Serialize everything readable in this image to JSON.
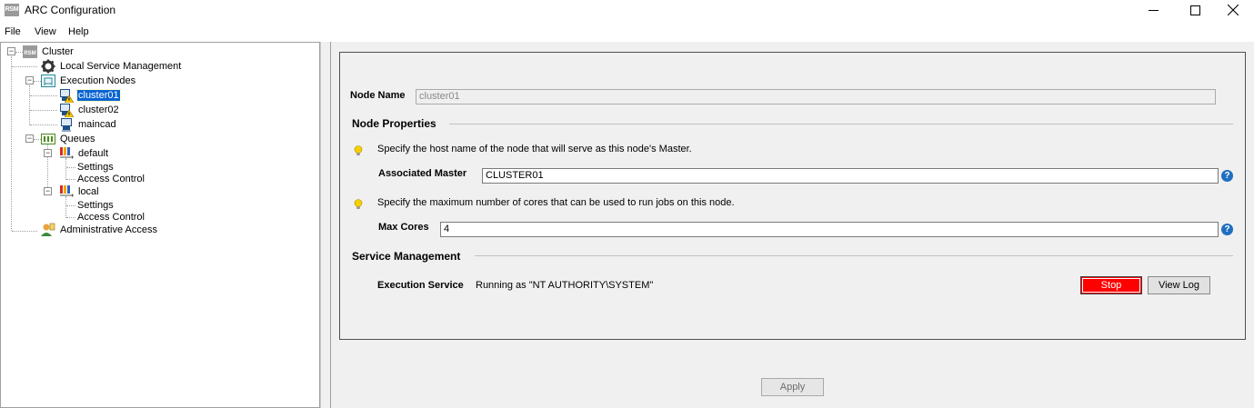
{
  "window": {
    "app_icon_text": "RSM",
    "title": "ARC Configuration"
  },
  "menu": {
    "items": [
      "File",
      "View",
      "Help"
    ]
  },
  "tree": {
    "root": "Cluster",
    "local_service_management": "Local Service Management",
    "execution_nodes": "Execution Nodes",
    "nodes": [
      "cluster01",
      "cluster02",
      "maincad"
    ],
    "queues": "Queues",
    "queue_default": "default",
    "queue_local": "local",
    "settings": "Settings",
    "access_control": "Access Control",
    "administrative_access": "Administrative Access",
    "selected": "cluster01"
  },
  "main": {
    "node_name_label": "Node Name",
    "node_name_value": "cluster01",
    "node_properties_title": "Node Properties",
    "master_hint": "Specify the host name of the node that will serve as this node's Master.",
    "associated_master_label": "Associated Master",
    "associated_master_value": "CLUSTER01",
    "cores_hint": "Specify the maximum number of cores that can be used to run jobs on this node.",
    "max_cores_label": "Max Cores",
    "max_cores_value": "4",
    "service_management_title": "Service Management",
    "execution_service_label": "Execution Service",
    "execution_service_status": "Running as \"NT AUTHORITY\\SYSTEM\"",
    "stop_label": "Stop",
    "view_log_label": "View Log",
    "apply_label": "Apply",
    "help_glyph": "?"
  },
  "colors": {
    "selection": "#0a64d2",
    "stop_button": "#ff0000",
    "help_icon": "#1f6fc0",
    "panel_bg": "#f0f0f0"
  }
}
